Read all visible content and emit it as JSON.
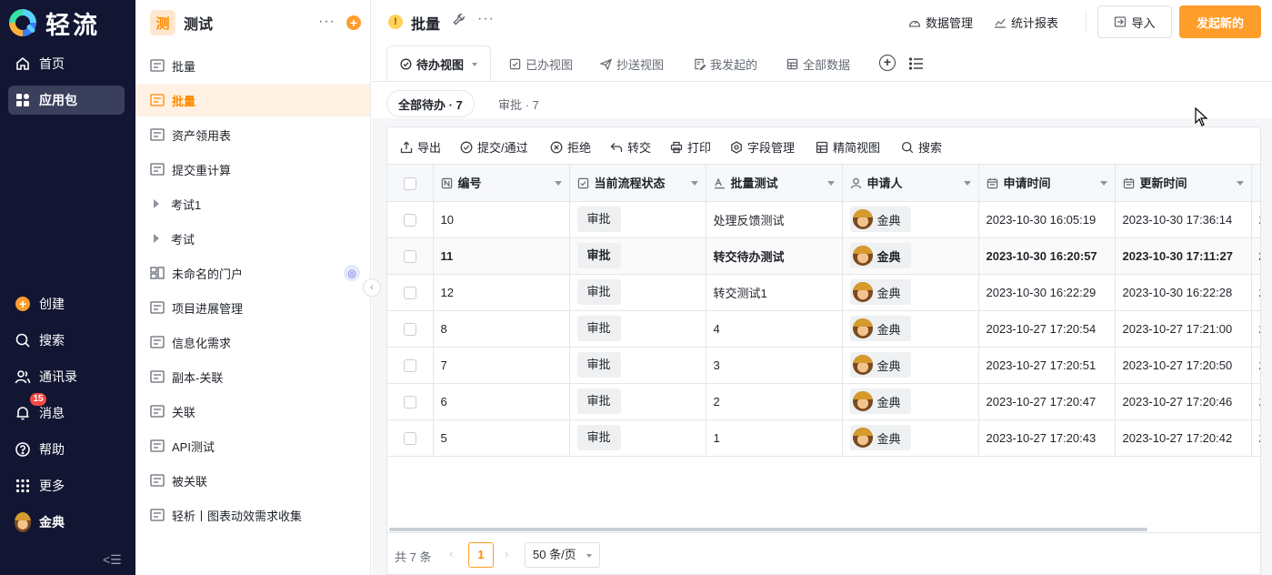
{
  "brand": {
    "name": "轻流"
  },
  "nav": {
    "top": [
      {
        "label": "首页",
        "icon": "home-icon"
      },
      {
        "label": "应用包",
        "icon": "apps-icon",
        "active": true
      }
    ],
    "bottom": [
      {
        "label": "创建",
        "icon": "plus-circle-icon"
      },
      {
        "label": "搜索",
        "icon": "search-icon"
      },
      {
        "label": "通讯录",
        "icon": "contacts-icon"
      },
      {
        "label": "消息",
        "icon": "bell-icon",
        "badge": "15"
      },
      {
        "label": "帮助",
        "icon": "help-icon"
      },
      {
        "label": "更多",
        "icon": "grid-icon"
      },
      {
        "label": "金典",
        "icon": "avatar"
      }
    ]
  },
  "package": {
    "logo": "测",
    "title": "测试",
    "items": [
      {
        "label": "批量",
        "icon": "form-icon"
      },
      {
        "label": "批量",
        "icon": "form-icon",
        "active": true
      },
      {
        "label": "资产领用表",
        "icon": "form-icon"
      },
      {
        "label": "提交重计算",
        "icon": "form-icon"
      },
      {
        "label": "考试1",
        "icon": "folder-caret"
      },
      {
        "label": "考试",
        "icon": "folder-caret"
      },
      {
        "label": "未命名的门户",
        "icon": "portal-icon",
        "globe": true
      },
      {
        "label": "项目进展管理",
        "icon": "form-icon"
      },
      {
        "label": "信息化需求",
        "icon": "form-icon"
      },
      {
        "label": "副本-关联",
        "icon": "form-icon"
      },
      {
        "label": "关联",
        "icon": "form-icon"
      },
      {
        "label": "API测试",
        "icon": "form-icon"
      },
      {
        "label": "被关联",
        "icon": "form-icon"
      },
      {
        "label": "轻析丨图表动效需求收集",
        "icon": "form-icon"
      }
    ]
  },
  "topbar": {
    "title": "批量",
    "data_manage": "数据管理",
    "report": "统计报表",
    "import": "导入",
    "primary": "发起新的"
  },
  "tabs": [
    {
      "label": "待办视图",
      "icon": "check-circle-icon",
      "active": true
    },
    {
      "label": "已办视图",
      "icon": "check-square-icon"
    },
    {
      "label": "抄送视图",
      "icon": "send-icon"
    },
    {
      "label": "我发起的",
      "icon": "edit-doc-icon"
    },
    {
      "label": "全部数据",
      "icon": "table-icon"
    }
  ],
  "filters": [
    {
      "label": "全部待办 · 7",
      "active": true
    },
    {
      "label": "审批 · 7"
    }
  ],
  "toolbar": [
    {
      "label": "导出",
      "icon": "export-icon"
    },
    {
      "label": "提交/通过",
      "icon": "check-circle-icon"
    },
    {
      "label": "拒绝",
      "icon": "reject-icon"
    },
    {
      "label": "转交",
      "icon": "transfer-icon"
    },
    {
      "label": "打印",
      "icon": "print-icon"
    },
    {
      "label": "字段管理",
      "icon": "settings-icon"
    },
    {
      "label": "精简视图",
      "icon": "table-icon"
    },
    {
      "label": "搜索",
      "icon": "search-icon"
    }
  ],
  "table": {
    "columns": [
      {
        "label": "编号",
        "icon": "number-icon"
      },
      {
        "label": "当前流程状态",
        "icon": "check-square-icon"
      },
      {
        "label": "批量测试",
        "icon": "text-icon"
      },
      {
        "label": "申请人",
        "icon": "user-icon"
      },
      {
        "label": "申请时间",
        "icon": "calendar-icon"
      },
      {
        "label": "更新时间",
        "icon": "calendar-icon"
      }
    ],
    "rows": [
      {
        "id": "10",
        "status": "审批",
        "test": "处理反馈测试",
        "applicant": "金典",
        "created": "2023-10-30 16:05:19",
        "updated": "2023-10-30 17:36:14",
        "extra": "2"
      },
      {
        "id": "11",
        "status": "审批",
        "test": "转交待办测试",
        "applicant": "金典",
        "created": "2023-10-30 16:20:57",
        "updated": "2023-10-30 17:11:27",
        "extra": "2",
        "bold": true
      },
      {
        "id": "12",
        "status": "审批",
        "test": "转交测试1",
        "applicant": "金典",
        "created": "2023-10-30 16:22:29",
        "updated": "2023-10-30 16:22:28",
        "extra": "2"
      },
      {
        "id": "8",
        "status": "审批",
        "test": "4",
        "applicant": "金典",
        "created": "2023-10-27 17:20:54",
        "updated": "2023-10-27 17:21:00",
        "extra": "2"
      },
      {
        "id": "7",
        "status": "审批",
        "test": "3",
        "applicant": "金典",
        "created": "2023-10-27 17:20:51",
        "updated": "2023-10-27 17:20:50",
        "extra": "2"
      },
      {
        "id": "6",
        "status": "审批",
        "test": "2",
        "applicant": "金典",
        "created": "2023-10-27 17:20:47",
        "updated": "2023-10-27 17:20:46",
        "extra": "2"
      },
      {
        "id": "5",
        "status": "审批",
        "test": "1",
        "applicant": "金典",
        "created": "2023-10-27 17:20:43",
        "updated": "2023-10-27 17:20:42",
        "extra": "2"
      }
    ]
  },
  "footer": {
    "total": "共 7 条",
    "page": "1",
    "page_size": "50 条/页"
  },
  "colors": {
    "accent": "#ff9d2b",
    "nav_bg": "#121633"
  }
}
